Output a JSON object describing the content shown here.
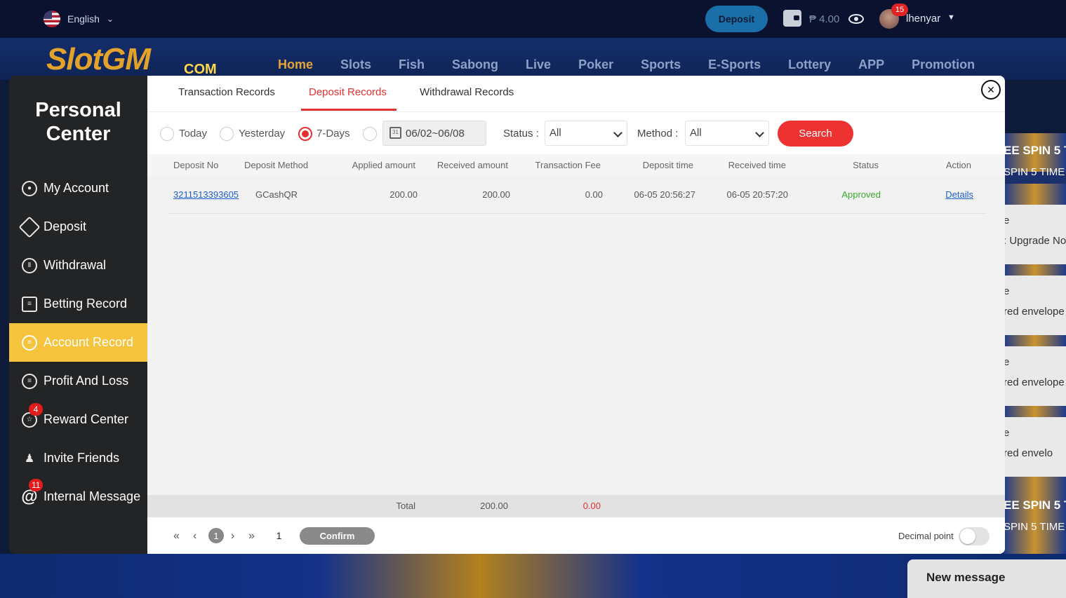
{
  "topbar": {
    "language": "English",
    "deposit_label": "Deposit",
    "balance": "₱ 4.00",
    "username": "lhenyar",
    "notification_count": "15"
  },
  "site": {
    "logo_main": "SlotGM",
    "logo_suffix": "COM",
    "nav": [
      "Home",
      "Slots",
      "Fish",
      "Sabong",
      "Live",
      "Poker",
      "Sports",
      "E-Sports",
      "Lottery",
      "APP",
      "Promotion"
    ]
  },
  "sidebar": {
    "title": "Personal Center",
    "items": [
      {
        "label": "My Account",
        "icon": "account-icon"
      },
      {
        "label": "Deposit",
        "icon": "deposit-icon"
      },
      {
        "label": "Withdrawal",
        "icon": "withdrawal-icon"
      },
      {
        "label": "Betting Record",
        "icon": "clipboard-icon"
      },
      {
        "label": "Account Record",
        "icon": "record-icon",
        "active": true
      },
      {
        "label": "Profit And Loss",
        "icon": "profit-icon"
      },
      {
        "label": "Reward Center",
        "icon": "star-icon",
        "badge": "4"
      },
      {
        "label": "Invite Friends",
        "icon": "friends-icon"
      },
      {
        "label": "Internal Message",
        "icon": "at-icon",
        "badge": "11"
      }
    ]
  },
  "tabs": [
    "Transaction Records",
    "Deposit Records",
    "Withdrawal Records"
  ],
  "filters": {
    "ranges": [
      "Today",
      "Yesterday",
      "7-Days"
    ],
    "selected_range": "7-Days",
    "date_range": "06/02~06/08",
    "status_label": "Status :",
    "status_value": "All",
    "method_label": "Method :",
    "method_value": "All",
    "search_label": "Search"
  },
  "table": {
    "columns": [
      "Deposit No",
      "Deposit Method",
      "Applied amount",
      "Received amount",
      "Transaction Fee",
      "Deposit time",
      "Received time",
      "Status",
      "Action"
    ],
    "rows": [
      [
        "3211513393605",
        "GCashQR",
        "200.00",
        "200.00",
        "0.00",
        "06-05 20:56:27",
        "06-05 20:57:20",
        "Approved",
        "Details"
      ]
    ],
    "total_label": "Total",
    "total_received": "200.00",
    "total_fee": "0.00"
  },
  "pager": {
    "current_page": "1",
    "jump_value": "1",
    "confirm_label": "Confirm",
    "decimal_label": "Decimal point"
  },
  "side_promos": [
    "EE SPIN 5 T",
    "SPIN 5 TIME",
    "e",
    ": Upgrade No",
    "e",
    "red envelope",
    "e",
    "red envelope",
    "e",
    "red envelo",
    "EE SPIN 5 T",
    "SPIN 5 TIME"
  ],
  "new_message": "New message",
  "colors": {
    "accent": "#e5302f",
    "active_menu": "#f6c33c",
    "approved": "#3aa82e",
    "link": "#1b5fce"
  }
}
